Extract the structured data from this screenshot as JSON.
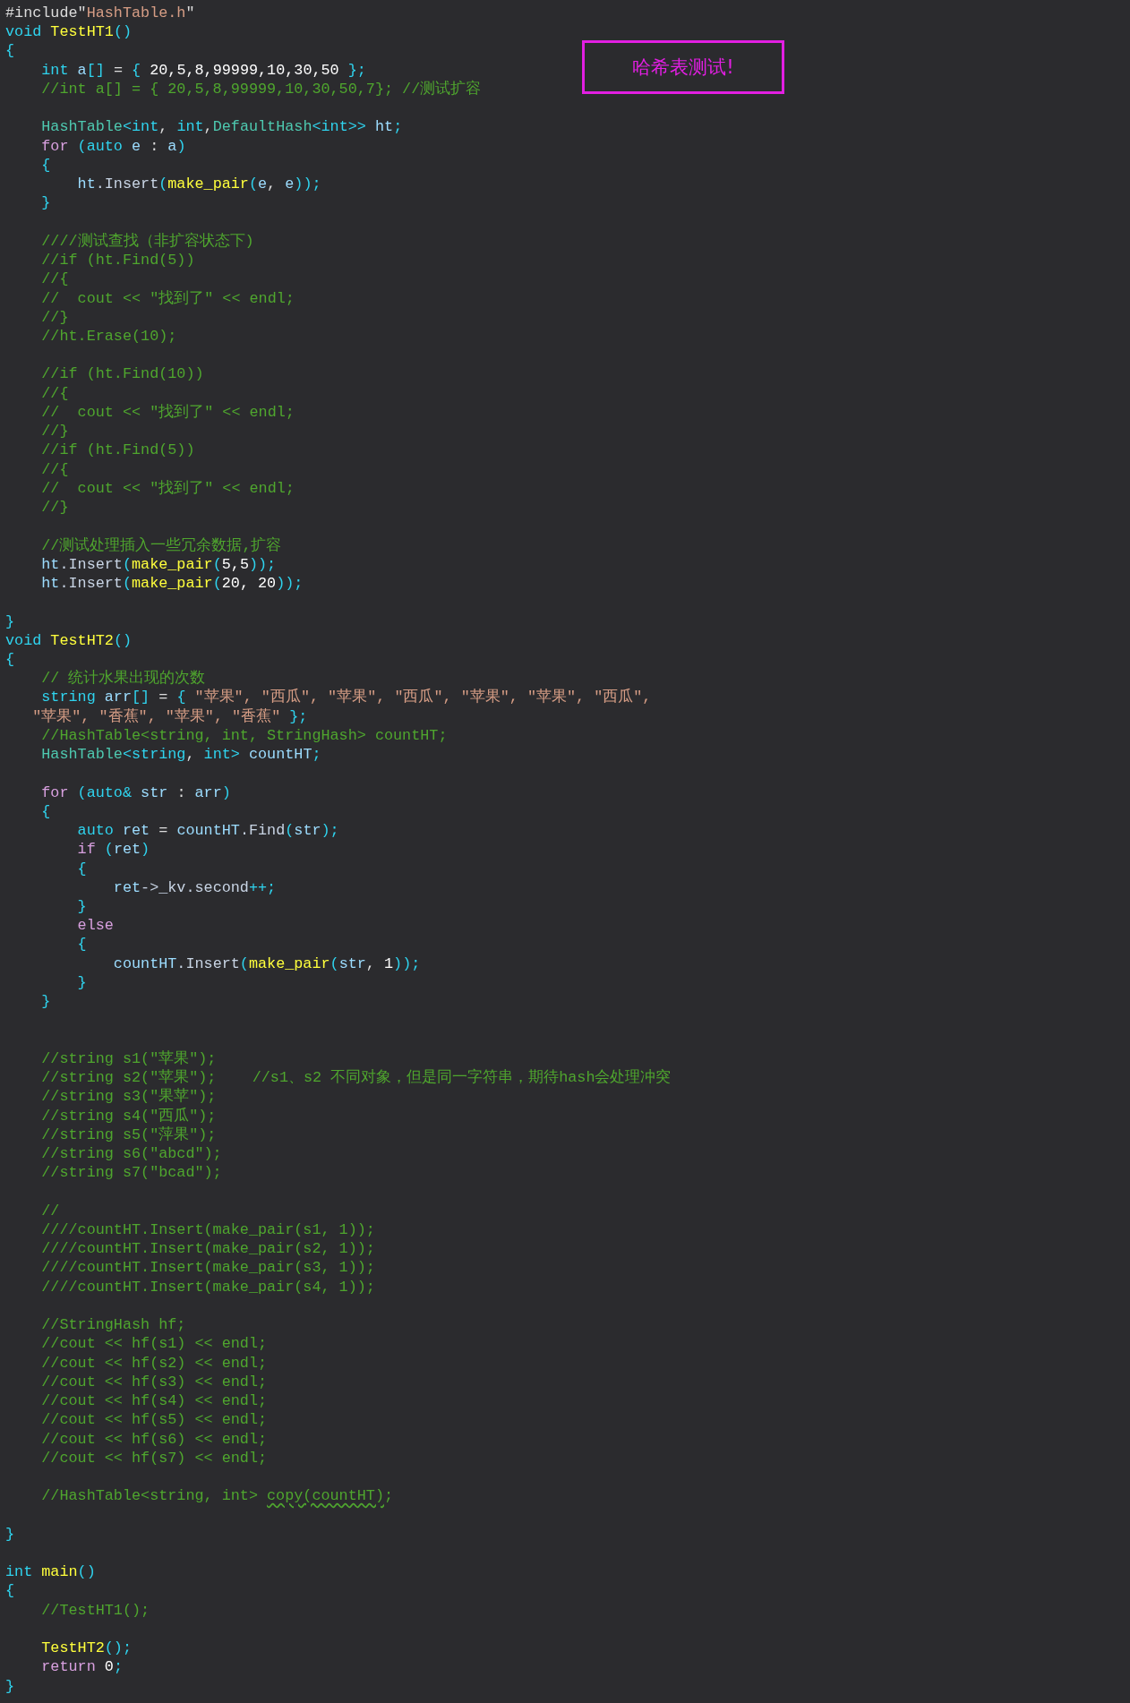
{
  "editor": {
    "lines": [
      {
        "kind": "code",
        "tokens": [
          {
            "kind": "txt",
            "text": "#include\""
          },
          {
            "kind": "str",
            "text": "HashTable.h"
          },
          {
            "kind": "txt",
            "text": "\""
          }
        ]
      },
      {
        "kind": "code",
        "tokens": [
          {
            "kind": "type",
            "text": "void"
          },
          {
            "kind": "fn",
            "text": " TestHT1"
          },
          {
            "kind": "pun",
            "text": "()"
          }
        ]
      },
      {
        "kind": "code",
        "tokens": [
          {
            "kind": "pun",
            "text": "{"
          }
        ]
      },
      {
        "kind": "code",
        "tokens": [
          {
            "kind": "type",
            "text": "    int"
          },
          {
            "kind": "var",
            "text": " a"
          },
          {
            "kind": "pun",
            "text": "[]"
          },
          {
            "kind": "txt",
            "text": " = "
          },
          {
            "kind": "pun",
            "text": "{"
          },
          {
            "kind": "num",
            "text": " 20,5,8,99999,10,30,50 "
          },
          {
            "kind": "pun",
            "text": "};"
          }
        ]
      },
      {
        "kind": "code",
        "tokens": [
          {
            "kind": "cmt",
            "text": "    //int a[] = { 20,5,8,99999,10,30,50,7}; //测试扩容"
          }
        ]
      },
      {
        "kind": "blank"
      },
      {
        "kind": "code",
        "tokens": [
          {
            "kind": "cls",
            "text": "    HashTable"
          },
          {
            "kind": "pun",
            "text": "<"
          },
          {
            "kind": "type",
            "text": "int"
          },
          {
            "kind": "txt",
            "text": ", "
          },
          {
            "kind": "type",
            "text": "int"
          },
          {
            "kind": "txt",
            "text": ","
          },
          {
            "kind": "cls",
            "text": "DefaultHash"
          },
          {
            "kind": "pun",
            "text": "<"
          },
          {
            "kind": "type",
            "text": "int"
          },
          {
            "kind": "pun",
            "text": ">>"
          },
          {
            "kind": "var",
            "text": " ht"
          },
          {
            "kind": "pun",
            "text": ";"
          }
        ]
      },
      {
        "kind": "code",
        "tokens": [
          {
            "kind": "kw",
            "text": "    for"
          },
          {
            "kind": "pun",
            "text": " ("
          },
          {
            "kind": "type",
            "text": "auto"
          },
          {
            "kind": "var",
            "text": " e"
          },
          {
            "kind": "txt",
            "text": " : "
          },
          {
            "kind": "var",
            "text": "a"
          },
          {
            "kind": "pun",
            "text": ")"
          }
        ]
      },
      {
        "kind": "code",
        "tokens": [
          {
            "kind": "pun",
            "text": "    {"
          }
        ]
      },
      {
        "kind": "code",
        "tokens": [
          {
            "kind": "var",
            "text": "        ht"
          },
          {
            "kind": "mem",
            "text": ".Insert"
          },
          {
            "kind": "pun",
            "text": "("
          },
          {
            "kind": "fn",
            "text": "make_pair"
          },
          {
            "kind": "pun",
            "text": "("
          },
          {
            "kind": "var",
            "text": "e"
          },
          {
            "kind": "txt",
            "text": ", "
          },
          {
            "kind": "var",
            "text": "e"
          },
          {
            "kind": "pun",
            "text": "));"
          }
        ]
      },
      {
        "kind": "code",
        "tokens": [
          {
            "kind": "pun",
            "text": "    }"
          }
        ]
      },
      {
        "kind": "blank"
      },
      {
        "kind": "code",
        "tokens": [
          {
            "kind": "cmt",
            "text": "    ////测试查找（非扩容状态下)"
          }
        ]
      },
      {
        "kind": "code",
        "tokens": [
          {
            "kind": "cmt",
            "text": "    //if (ht.Find(5))"
          }
        ]
      },
      {
        "kind": "code",
        "tokens": [
          {
            "kind": "cmt",
            "text": "    //{"
          }
        ]
      },
      {
        "kind": "code",
        "tokens": [
          {
            "kind": "cmt",
            "text": "    //  cout << \"找到了\" << endl;"
          }
        ]
      },
      {
        "kind": "code",
        "tokens": [
          {
            "kind": "cmt",
            "text": "    //}"
          }
        ]
      },
      {
        "kind": "code",
        "tokens": [
          {
            "kind": "cmt",
            "text": "    //ht.Erase(10);"
          }
        ]
      },
      {
        "kind": "blank"
      },
      {
        "kind": "code",
        "tokens": [
          {
            "kind": "cmt",
            "text": "    //if (ht.Find(10))"
          }
        ]
      },
      {
        "kind": "code",
        "tokens": [
          {
            "kind": "cmt",
            "text": "    //{"
          }
        ]
      },
      {
        "kind": "code",
        "tokens": [
          {
            "kind": "cmt",
            "text": "    //  cout << \"找到了\" << endl;"
          }
        ]
      },
      {
        "kind": "code",
        "tokens": [
          {
            "kind": "cmt",
            "text": "    //}"
          }
        ]
      },
      {
        "kind": "code",
        "tokens": [
          {
            "kind": "cmt",
            "text": "    //if (ht.Find(5))"
          }
        ]
      },
      {
        "kind": "code",
        "tokens": [
          {
            "kind": "cmt",
            "text": "    //{"
          }
        ]
      },
      {
        "kind": "code",
        "tokens": [
          {
            "kind": "cmt",
            "text": "    //  cout << \"找到了\" << endl;"
          }
        ]
      },
      {
        "kind": "code",
        "tokens": [
          {
            "kind": "cmt",
            "text": "    //}"
          }
        ]
      },
      {
        "kind": "blank"
      },
      {
        "kind": "code",
        "tokens": [
          {
            "kind": "cmt",
            "text": "    //测试处理插入一些冗余数据,扩容"
          }
        ]
      },
      {
        "kind": "code",
        "tokens": [
          {
            "kind": "var",
            "text": "    ht"
          },
          {
            "kind": "mem",
            "text": ".Insert"
          },
          {
            "kind": "pun",
            "text": "("
          },
          {
            "kind": "fn",
            "text": "make_pair"
          },
          {
            "kind": "pun",
            "text": "("
          },
          {
            "kind": "num",
            "text": "5,5"
          },
          {
            "kind": "pun",
            "text": "));"
          }
        ]
      },
      {
        "kind": "code",
        "tokens": [
          {
            "kind": "var",
            "text": "    ht"
          },
          {
            "kind": "mem",
            "text": ".Insert"
          },
          {
            "kind": "pun",
            "text": "("
          },
          {
            "kind": "fn",
            "text": "make_pair"
          },
          {
            "kind": "pun",
            "text": "("
          },
          {
            "kind": "num",
            "text": "20, 20"
          },
          {
            "kind": "pun",
            "text": "));"
          }
        ]
      },
      {
        "kind": "blank"
      },
      {
        "kind": "code",
        "tokens": [
          {
            "kind": "pun",
            "text": "}"
          }
        ]
      },
      {
        "kind": "code",
        "tokens": [
          {
            "kind": "type",
            "text": "void"
          },
          {
            "kind": "fn",
            "text": " TestHT2"
          },
          {
            "kind": "pun",
            "text": "()"
          }
        ]
      },
      {
        "kind": "code",
        "tokens": [
          {
            "kind": "pun",
            "text": "{"
          }
        ]
      },
      {
        "kind": "code",
        "tokens": [
          {
            "kind": "cmt",
            "text": "    // 统计水果出现的次数"
          }
        ]
      },
      {
        "kind": "code",
        "tokens": [
          {
            "kind": "type",
            "text": "    string"
          },
          {
            "kind": "var",
            "text": " arr"
          },
          {
            "kind": "pun",
            "text": "[]"
          },
          {
            "kind": "txt",
            "text": " = "
          },
          {
            "kind": "pun",
            "text": "{"
          },
          {
            "kind": "str",
            "text": " \"苹果\", \"西瓜\", \"苹果\", \"西瓜\", \"苹果\", \"苹果\", \"西瓜\","
          }
        ]
      },
      {
        "kind": "code",
        "tokens": [
          {
            "kind": "str",
            "text": "   \"苹果\", \"香蕉\", \"苹果\", \"香蕉\""
          },
          {
            "kind": "pun",
            "text": " };"
          }
        ]
      },
      {
        "kind": "code",
        "tokens": [
          {
            "kind": "cmt",
            "text": "    //HashTable<string, int, StringHash> countHT;"
          }
        ]
      },
      {
        "kind": "code",
        "tokens": [
          {
            "kind": "cls",
            "text": "    HashTable"
          },
          {
            "kind": "pun",
            "text": "<"
          },
          {
            "kind": "type",
            "text": "string"
          },
          {
            "kind": "txt",
            "text": ", "
          },
          {
            "kind": "type",
            "text": "int"
          },
          {
            "kind": "pun",
            "text": ">"
          },
          {
            "kind": "var",
            "text": " countHT"
          },
          {
            "kind": "pun",
            "text": ";"
          }
        ]
      },
      {
        "kind": "blank"
      },
      {
        "kind": "code",
        "tokens": [
          {
            "kind": "kw",
            "text": "    for"
          },
          {
            "kind": "pun",
            "text": " ("
          },
          {
            "kind": "type",
            "text": "auto&"
          },
          {
            "kind": "var",
            "text": " str"
          },
          {
            "kind": "txt",
            "text": " : "
          },
          {
            "kind": "var",
            "text": "arr"
          },
          {
            "kind": "pun",
            "text": ")"
          }
        ]
      },
      {
        "kind": "code",
        "tokens": [
          {
            "kind": "pun",
            "text": "    {"
          }
        ]
      },
      {
        "kind": "code",
        "tokens": [
          {
            "kind": "type",
            "text": "        auto"
          },
          {
            "kind": "var",
            "text": " ret"
          },
          {
            "kind": "txt",
            "text": " = "
          },
          {
            "kind": "var",
            "text": "countHT"
          },
          {
            "kind": "mem",
            "text": ".Find"
          },
          {
            "kind": "pun",
            "text": "("
          },
          {
            "kind": "var",
            "text": "str"
          },
          {
            "kind": "pun",
            "text": ");"
          }
        ]
      },
      {
        "kind": "code",
        "tokens": [
          {
            "kind": "kw",
            "text": "        if"
          },
          {
            "kind": "pun",
            "text": " ("
          },
          {
            "kind": "var",
            "text": "ret"
          },
          {
            "kind": "pun",
            "text": ")"
          }
        ]
      },
      {
        "kind": "code",
        "tokens": [
          {
            "kind": "pun",
            "text": "        {"
          }
        ]
      },
      {
        "kind": "code",
        "tokens": [
          {
            "kind": "var",
            "text": "            ret"
          },
          {
            "kind": "mem",
            "text": "->_kv.second"
          },
          {
            "kind": "pun",
            "text": "++;"
          }
        ]
      },
      {
        "kind": "code",
        "tokens": [
          {
            "kind": "pun",
            "text": "        }"
          }
        ]
      },
      {
        "kind": "code",
        "tokens": [
          {
            "kind": "kw",
            "text": "        else"
          }
        ]
      },
      {
        "kind": "code",
        "tokens": [
          {
            "kind": "pun",
            "text": "        {"
          }
        ]
      },
      {
        "kind": "code",
        "tokens": [
          {
            "kind": "var",
            "text": "            countHT"
          },
          {
            "kind": "mem",
            "text": ".Insert"
          },
          {
            "kind": "pun",
            "text": "("
          },
          {
            "kind": "fn",
            "text": "make_pair"
          },
          {
            "kind": "pun",
            "text": "("
          },
          {
            "kind": "var",
            "text": "str"
          },
          {
            "kind": "txt",
            "text": ", "
          },
          {
            "kind": "num",
            "text": "1"
          },
          {
            "kind": "pun",
            "text": "));"
          }
        ]
      },
      {
        "kind": "code",
        "tokens": [
          {
            "kind": "pun",
            "text": "        }"
          }
        ]
      },
      {
        "kind": "code",
        "tokens": [
          {
            "kind": "pun",
            "text": "    }"
          }
        ]
      },
      {
        "kind": "blank"
      },
      {
        "kind": "blank"
      },
      {
        "kind": "code",
        "tokens": [
          {
            "kind": "cmt",
            "text": "    //string s1(\"苹果\");"
          }
        ]
      },
      {
        "kind": "code",
        "tokens": [
          {
            "kind": "cmt",
            "text": "    //string s2(\"苹果\");    //s1、s2 不同对象，但是同一字符串，期待hash会处理冲突"
          }
        ]
      },
      {
        "kind": "code",
        "tokens": [
          {
            "kind": "cmt",
            "text": "    //string s3(\"果苹\");"
          }
        ]
      },
      {
        "kind": "code",
        "tokens": [
          {
            "kind": "cmt",
            "text": "    //string s4(\"西瓜\");"
          }
        ]
      },
      {
        "kind": "code",
        "tokens": [
          {
            "kind": "cmt",
            "text": "    //string s5(\"萍果\");"
          }
        ]
      },
      {
        "kind": "code",
        "tokens": [
          {
            "kind": "cmt",
            "text": "    //string s6(\"abcd\");"
          }
        ]
      },
      {
        "kind": "code",
        "tokens": [
          {
            "kind": "cmt",
            "text": "    //string s7(\"bcad\");"
          }
        ]
      },
      {
        "kind": "blank"
      },
      {
        "kind": "code",
        "tokens": [
          {
            "kind": "cmt",
            "text": "    //"
          }
        ]
      },
      {
        "kind": "code",
        "tokens": [
          {
            "kind": "cmt",
            "text": "    ////countHT.Insert(make_pair(s1, 1));"
          }
        ]
      },
      {
        "kind": "code",
        "tokens": [
          {
            "kind": "cmt",
            "text": "    ////countHT.Insert(make_pair(s2, 1));"
          }
        ]
      },
      {
        "kind": "code",
        "tokens": [
          {
            "kind": "cmt",
            "text": "    ////countHT.Insert(make_pair(s3, 1));"
          }
        ]
      },
      {
        "kind": "code",
        "tokens": [
          {
            "kind": "cmt",
            "text": "    ////countHT.Insert(make_pair(s4, 1));"
          }
        ]
      },
      {
        "kind": "blank"
      },
      {
        "kind": "code",
        "tokens": [
          {
            "kind": "cmt",
            "text": "    //StringHash hf;"
          }
        ]
      },
      {
        "kind": "code",
        "tokens": [
          {
            "kind": "cmt",
            "text": "    //cout << hf(s1) << endl;"
          }
        ]
      },
      {
        "kind": "code",
        "tokens": [
          {
            "kind": "cmt",
            "text": "    //cout << hf(s2) << endl;"
          }
        ]
      },
      {
        "kind": "code",
        "tokens": [
          {
            "kind": "cmt",
            "text": "    //cout << hf(s3) << endl;"
          }
        ]
      },
      {
        "kind": "code",
        "tokens": [
          {
            "kind": "cmt",
            "text": "    //cout << hf(s4) << endl;"
          }
        ]
      },
      {
        "kind": "code",
        "tokens": [
          {
            "kind": "cmt",
            "text": "    //cout << hf(s5) << endl;"
          }
        ]
      },
      {
        "kind": "code",
        "tokens": [
          {
            "kind": "cmt",
            "text": "    //cout << hf(s6) << endl;"
          }
        ]
      },
      {
        "kind": "code",
        "tokens": [
          {
            "kind": "cmt",
            "text": "    //cout << hf(s7) << endl;"
          }
        ]
      },
      {
        "kind": "blank"
      },
      {
        "kind": "code",
        "tokens": [
          {
            "kind": "cmt",
            "text": "    //HashTable<string, int> "
          },
          {
            "kind": "squiggle",
            "text": "copy(countHT)"
          },
          {
            "kind": "cmt",
            "text": ";"
          }
        ]
      },
      {
        "kind": "blank"
      },
      {
        "kind": "code",
        "tokens": [
          {
            "kind": "pun",
            "text": "}"
          }
        ]
      },
      {
        "kind": "blank"
      },
      {
        "kind": "code",
        "tokens": [
          {
            "kind": "type",
            "text": "int"
          },
          {
            "kind": "fn",
            "text": " main"
          },
          {
            "kind": "pun",
            "text": "()"
          }
        ]
      },
      {
        "kind": "code",
        "tokens": [
          {
            "kind": "pun",
            "text": "{"
          }
        ]
      },
      {
        "kind": "code",
        "tokens": [
          {
            "kind": "cmt",
            "text": "    //TestHT1();"
          }
        ]
      },
      {
        "kind": "blank"
      },
      {
        "kind": "code",
        "tokens": [
          {
            "kind": "fn",
            "text": "    TestHT2"
          },
          {
            "kind": "pun",
            "text": "();"
          }
        ]
      },
      {
        "kind": "code",
        "tokens": [
          {
            "kind": "kw",
            "text": "    return"
          },
          {
            "kind": "num",
            "text": " 0"
          },
          {
            "kind": "pun",
            "text": ";"
          }
        ]
      },
      {
        "kind": "code",
        "tokens": [
          {
            "kind": "pun",
            "text": "}"
          }
        ]
      }
    ]
  },
  "note": {
    "text": "哈希表测试!"
  }
}
